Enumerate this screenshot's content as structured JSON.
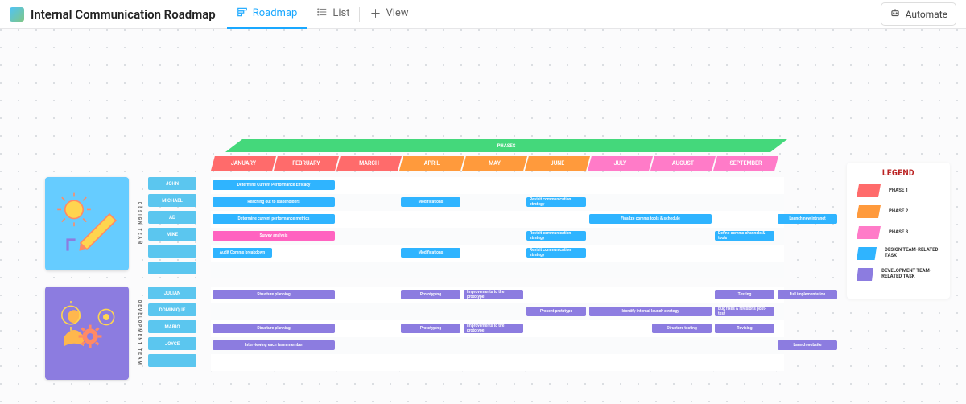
{
  "header": {
    "title": "Internal Communication Roadmap",
    "views": {
      "roadmap": "Roadmap",
      "list": "List",
      "add": "View"
    },
    "automate": "Automate"
  },
  "legend": {
    "title": "LEGEND",
    "items": [
      {
        "label": "PHASE 1",
        "color": "#ff6b6b"
      },
      {
        "label": "PHASE 2",
        "color": "#ff9a3c"
      },
      {
        "label": "PHASE 3",
        "color": "#ff7bc8"
      },
      {
        "label": "DESIGN TEAM-RELATED TASK",
        "color": "#2fb4ff"
      },
      {
        "label": "DEVELOPMENT TEAM-RELATED TASK",
        "color": "#8c7ce0"
      }
    ]
  },
  "phases_label": "PHASES",
  "months": [
    {
      "label": "JANUARY",
      "color": "#ff6b6b"
    },
    {
      "label": "FEBRUARY",
      "color": "#ff6b6b"
    },
    {
      "label": "MARCH",
      "color": "#ff6b6b"
    },
    {
      "label": "APRIL",
      "color": "#ff9a3c"
    },
    {
      "label": "MAY",
      "color": "#ff9a3c"
    },
    {
      "label": "JUNE",
      "color": "#ff9a3c"
    },
    {
      "label": "JULY",
      "color": "#ff7bc8"
    },
    {
      "label": "AUGUST",
      "color": "#ff7bc8"
    },
    {
      "label": "SEPTEMBER",
      "color": "#ff7bc8"
    }
  ],
  "sections": {
    "design": {
      "label": "DESIGN TEAM",
      "people": [
        "JOHN",
        "MICHAEL",
        "AD",
        "MIKE",
        "",
        ""
      ],
      "tasks": [
        {
          "row": 0,
          "start": 0,
          "span": 2,
          "label": "Determine Current Performance Efficacy",
          "color": "#2fb4ff"
        },
        {
          "row": 1,
          "start": 0,
          "span": 2,
          "label": "Reaching out to stakeholders",
          "color": "#2fb4ff"
        },
        {
          "row": 1,
          "start": 3,
          "span": 1,
          "label": "Modifications",
          "color": "#2fb4ff"
        },
        {
          "row": 1,
          "start": 5,
          "span": 1,
          "label": "Revisit communication strategy",
          "color": "#2fb4ff"
        },
        {
          "row": 2,
          "start": 0,
          "span": 2,
          "label": "Determine current performance metrics",
          "color": "#2fb4ff"
        },
        {
          "row": 2,
          "start": 6,
          "span": 2,
          "label": "Finalize comms tools & schedule",
          "color": "#2fb4ff"
        },
        {
          "row": 2,
          "start": 9,
          "span": 1,
          "label": "Launch new intranet",
          "color": "#2fb4ff"
        },
        {
          "row": 3,
          "start": 0,
          "span": 2,
          "label": "Survey analysis",
          "color": "#ff63c0"
        },
        {
          "row": 3,
          "start": 5,
          "span": 1,
          "label": "Revisit communication strategy",
          "color": "#2fb4ff"
        },
        {
          "row": 3,
          "start": 8,
          "span": 1,
          "label": "Define comms channels & tools",
          "color": "#2fb4ff"
        },
        {
          "row": 4,
          "start": 0,
          "span": 1,
          "label": "Audit Comms breakdown",
          "color": "#2fb4ff"
        },
        {
          "row": 4,
          "start": 3,
          "span": 1,
          "label": "Modifications",
          "color": "#2fb4ff"
        },
        {
          "row": 4,
          "start": 5,
          "span": 1,
          "label": "Revisit communication strategy",
          "color": "#2fb4ff"
        }
      ]
    },
    "dev": {
      "label": "DEVELOPMENT TEAM",
      "people": [
        "JULIAN",
        "DOMINIQUE",
        "MARIO",
        "JOYCE",
        ""
      ],
      "tasks": [
        {
          "row": 0,
          "start": 0,
          "span": 2,
          "label": "Structure planning",
          "color": "#8c7ce0"
        },
        {
          "row": 0,
          "start": 3,
          "span": 1,
          "label": "Prototyping",
          "color": "#8c7ce0"
        },
        {
          "row": 0,
          "start": 4,
          "span": 1,
          "label": "Improvements to the prototype",
          "color": "#8c7ce0"
        },
        {
          "row": 0,
          "start": 8,
          "span": 1,
          "label": "Testing",
          "color": "#8c7ce0"
        },
        {
          "row": 0,
          "start": 9,
          "span": 1,
          "label": "Full implementation",
          "color": "#8c7ce0"
        },
        {
          "row": 1,
          "start": 5,
          "span": 1,
          "label": "Present prototype",
          "color": "#8c7ce0"
        },
        {
          "row": 1,
          "start": 6,
          "span": 2,
          "label": "Identify internal launch strategy",
          "color": "#8c7ce0"
        },
        {
          "row": 1,
          "start": 8,
          "span": 1,
          "label": "Bug fixes & revisions post-test",
          "color": "#8c7ce0"
        },
        {
          "row": 2,
          "start": 0,
          "span": 2,
          "label": "Structure planning",
          "color": "#8c7ce0"
        },
        {
          "row": 2,
          "start": 3,
          "span": 1,
          "label": "Prototyping",
          "color": "#8c7ce0"
        },
        {
          "row": 2,
          "start": 4,
          "span": 1,
          "label": "Improvements to the prototype",
          "color": "#8c7ce0"
        },
        {
          "row": 2,
          "start": 7,
          "span": 1,
          "label": "Structure testing",
          "color": "#8c7ce0"
        },
        {
          "row": 2,
          "start": 8,
          "span": 1,
          "label": "Revising",
          "color": "#8c7ce0"
        },
        {
          "row": 3,
          "start": 0,
          "span": 2,
          "label": "Interviewing each team member",
          "color": "#8c7ce0"
        },
        {
          "row": 3,
          "start": 9,
          "span": 1,
          "label": "Launch website",
          "color": "#8c7ce0"
        }
      ]
    }
  }
}
